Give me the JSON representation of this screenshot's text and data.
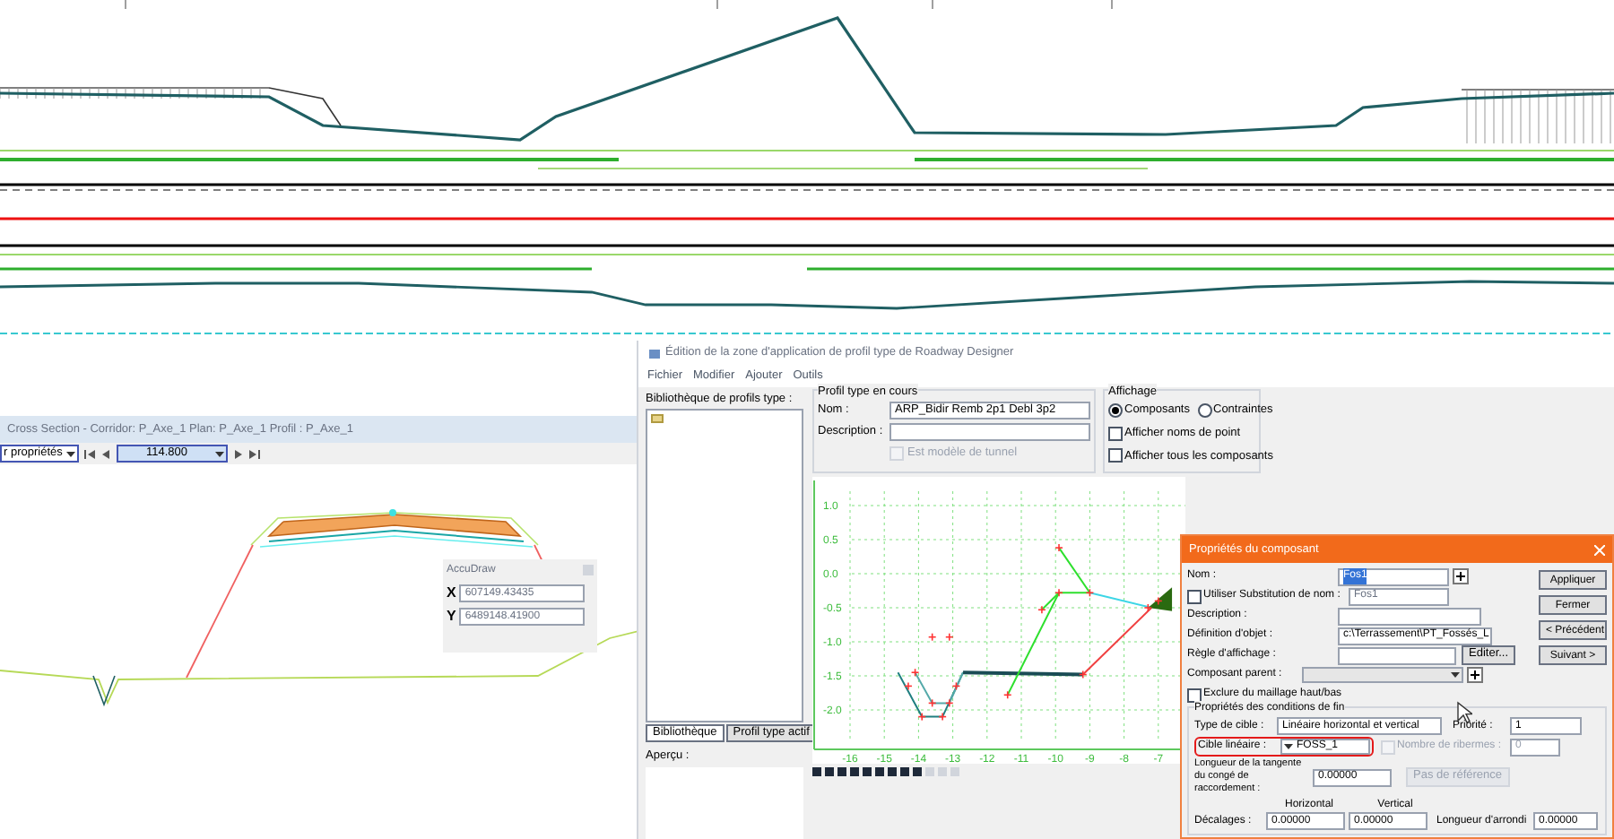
{
  "cross_section": {
    "title": "Cross Section - Corridor: P_Axe_1 Plan: P_Axe_1 Profil : P_Axe_1",
    "view_select": "r propriétés",
    "station": "114.800"
  },
  "accudraw": {
    "title": "AccuDraw",
    "fields": [
      {
        "label": "X",
        "value": "607149.43435"
      },
      {
        "label": "Y",
        "value": "6489148.41900"
      }
    ]
  },
  "designer": {
    "title": "Édition de la zone d'application de profil type de Roadway Designer",
    "menu": [
      "Fichier",
      "Modifier",
      "Ajouter",
      "Outils"
    ],
    "library_label": "Bibliothèque de profils type :",
    "current": {
      "legend": "Profil type en cours",
      "name_label": "Nom :",
      "name": "ARP_Bidir Remb 2p1 Debl 3p2",
      "description_label": "Description :",
      "tunnel": {
        "label": "Est modèle de tunnel",
        "checked": false
      }
    },
    "display": {
      "legend": "Affichage",
      "radios": [
        {
          "label": "Composants",
          "selected": true
        },
        {
          "label": "Contraintes",
          "selected": false
        }
      ],
      "checks": [
        {
          "label": "Afficher noms de point",
          "checked": false
        },
        {
          "label": "Afficher tous les composants",
          "checked": false
        }
      ]
    },
    "tabs": [
      {
        "label": "Bibliothèque",
        "selected": true
      },
      {
        "label": "Profil type actif",
        "selected": false
      }
    ],
    "preview_label": "Aperçu :",
    "y_ticks": [
      "1.0",
      "0.5",
      "0.0",
      "-0.5",
      "-1.0",
      "-1.5",
      "-2.0"
    ],
    "x_ticks": [
      "-16",
      "-15",
      "-14",
      "-13",
      "-12",
      "-11",
      "-10",
      "-9",
      "-8",
      "-7"
    ]
  },
  "properties": {
    "title": "Propriétés du composant",
    "name_label": "Nom :",
    "name": "Fos1",
    "substitution": {
      "label": "Utiliser Substitution de nom :",
      "checked": false,
      "value": "Fos1"
    },
    "description_label": "Description :",
    "object_label": "Définition d'objet :",
    "object": "c:\\Terrassement\\PT_Fossés_L",
    "display_rule_label": "Règle d'affichage :",
    "edit_button": "Editer...",
    "parent_label": "Composant parent :",
    "exclude": {
      "label": "Exclure du maillage haut/bas",
      "checked": false
    },
    "end_group": {
      "legend": "Propriétés des conditions de fin",
      "target_type_label": "Type de cible :",
      "target_type": "Linéaire horizontal et vertical",
      "priority_label": "Priorité :",
      "priority": "1",
      "linear_label": "Cible linéaire :",
      "linear": "FOSS_1",
      "berms": {
        "label": "Nombre de ribermes :",
        "checked": false,
        "value": "0"
      },
      "fillet_label": "Longueur de la tangente du congé de raccordement :",
      "fillet": "0.00000",
      "no_ref_button": "Pas de référence",
      "horizontal": "Horizontal",
      "vertical": "Vertical",
      "offsets_label": "Décalages :",
      "offset_h": "0.00000",
      "offset_v": "0.00000",
      "rounding_label": "Longueur d'arrondi",
      "rounding": "0.00000"
    },
    "buttons": [
      "Appliquer",
      "Fermer",
      "< Précédent",
      "Suivant >"
    ]
  }
}
